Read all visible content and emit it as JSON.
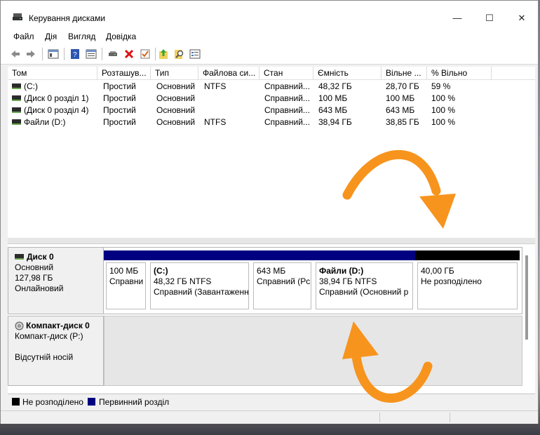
{
  "window": {
    "title": "Керування дисками",
    "controls": {
      "minimize": "—",
      "maximize": "☐",
      "close": "✕"
    }
  },
  "menu": [
    "Файл",
    "Дія",
    "Вигляд",
    "Довідка"
  ],
  "toolbar_icons": [
    "back-icon",
    "forward-icon",
    "console-tree-icon",
    "help-icon",
    "properties-icon",
    "connect-drive-icon",
    "delete-icon",
    "check-icon",
    "import-icon",
    "search-icon",
    "settings-icon"
  ],
  "volume_table": {
    "columns": [
      "Том",
      "Розташув...",
      "Тип",
      "Файлова си...",
      "Стан",
      "Ємність",
      "Вільне ...",
      "% Вільно"
    ],
    "rows": [
      [
        "(C:)",
        "Простий",
        "Основний",
        "NTFS",
        "Справний...",
        "48,32 ГБ",
        "28,70 ГБ",
        "59 %"
      ],
      [
        "(Диск 0 розділ 1)",
        "Простий",
        "Основний",
        "",
        "Справний...",
        "100 МБ",
        "100 МБ",
        "100 %"
      ],
      [
        "(Диск 0 розділ 4)",
        "Простий",
        "Основний",
        "",
        "Справний...",
        "643 МБ",
        "643 МБ",
        "100 %"
      ],
      [
        "Файли (D:)",
        "Простий",
        "Основний",
        "NTFS",
        "Справний...",
        "38,94 ГБ",
        "38,85 ГБ",
        "100 %"
      ]
    ]
  },
  "disks": [
    {
      "name": "Диск 0",
      "type": "Основний",
      "size": "127,98 ГБ",
      "status": "Онлайновий",
      "partitions": [
        {
          "title": "",
          "line1": "100 МБ",
          "line2": "Справни",
          "kind": "primary"
        },
        {
          "title": "(C:)",
          "line1": "48,32 ГБ NTFS",
          "line2": "Справний (Завантаженн",
          "kind": "primary"
        },
        {
          "title": "",
          "line1": "643 МБ",
          "line2": "Справний (Рс",
          "kind": "primary"
        },
        {
          "title": "Файли  (D:)",
          "line1": "38,94 ГБ NTFS",
          "line2": "Справний (Основний р",
          "kind": "primary"
        },
        {
          "title": "",
          "line1": "40,00 ГБ",
          "line2": "Не розподілено",
          "kind": "unallocated"
        }
      ]
    },
    {
      "name": "Компакт-диск 0",
      "line1": "Компакт-диск (P:)",
      "line2": "Відсутній носій"
    }
  ],
  "legend": [
    {
      "label": "Не розподілено",
      "color": "#000000"
    },
    {
      "label": "Первинний розділ",
      "color": "#000080"
    }
  ],
  "colors": {
    "primary": "#000080",
    "unallocated": "#000000",
    "arrow": "#f7941d"
  }
}
